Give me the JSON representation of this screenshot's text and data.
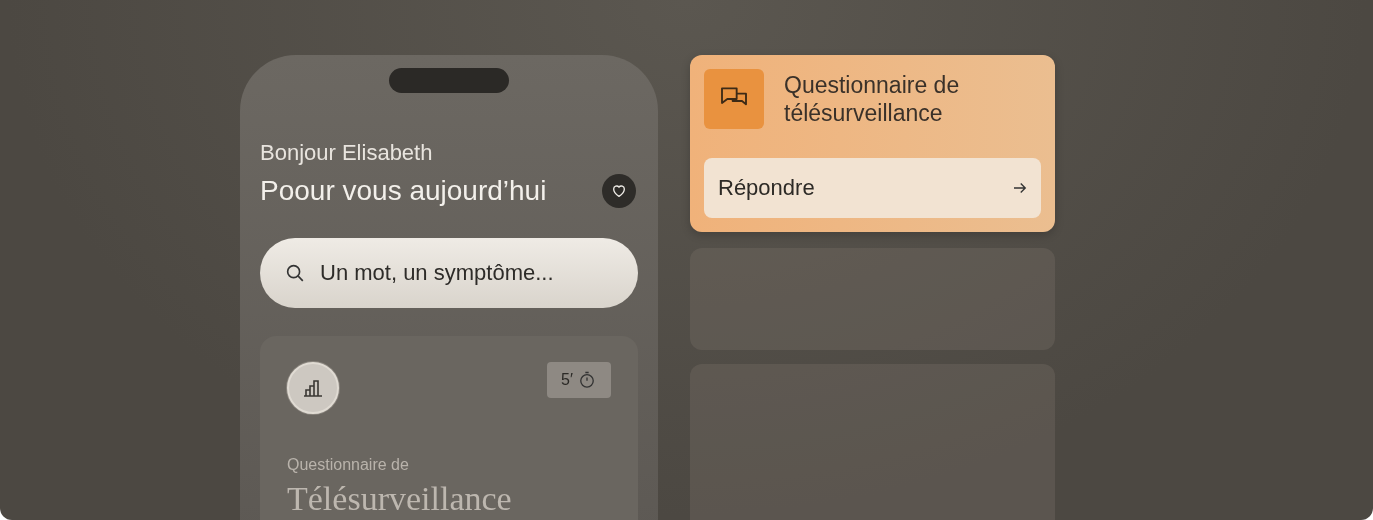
{
  "greeting": "Bonjour Elisabeth",
  "title": "Poour vous aujourd’hui",
  "search": {
    "placeholder": "Un mot, un symptôme..."
  },
  "survey_card": {
    "duration": "5′",
    "subtitle": "Questionnaire de",
    "title": "Télésurveillance"
  },
  "notification": {
    "title": "Questionnaire de télésurveillance",
    "action": "Répondre"
  }
}
